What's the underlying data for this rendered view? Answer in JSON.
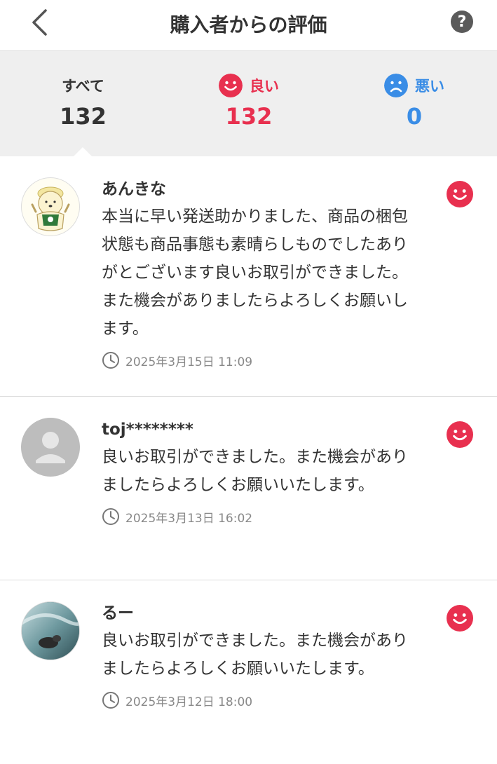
{
  "header": {
    "title": "購入者からの評価",
    "back_icon": "chevron-left-icon",
    "help_icon": "question-icon",
    "help_label": "?"
  },
  "tabs": [
    {
      "label": "すべて",
      "count": "132",
      "icon": "",
      "color": "#333333",
      "selected": true
    },
    {
      "label": "良い",
      "count": "132",
      "icon": "smile-face-icon",
      "color": "#e8304f",
      "selected": false
    },
    {
      "label": "悪い",
      "count": "0",
      "icon": "sad-face-icon",
      "color": "#3a8de6",
      "selected": false
    }
  ],
  "reviews": [
    {
      "name": "あんきな",
      "text": "本当に早い発送助かりました、商品の梱包状態も商品事態も素晴らしものでしたありがとございます良いお取引ができました。また機会がありましたらよろしくお願いします。",
      "date": "2025年3月15日 11:09",
      "rating_icon": "smile-face-icon",
      "avatar": "bear-illustration-avatar"
    },
    {
      "name": "toj********",
      "text": "良いお取引ができました。また機会がありましたらよろしくお願いいたします。",
      "date": "2025年3月13日 16:02",
      "rating_icon": "smile-face-icon",
      "avatar": "default-person-avatar"
    },
    {
      "name": "るー",
      "text": "良いお取引ができました。また機会がありましたらよろしくお願いいたします。",
      "date": "2025年3月12日 18:00",
      "rating_icon": "smile-face-icon",
      "avatar": "photo-avatar"
    }
  ],
  "colors": {
    "good": "#e8304f",
    "bad": "#3a8de6",
    "tab_background": "#efefef",
    "divider": "#dcdcdc"
  }
}
